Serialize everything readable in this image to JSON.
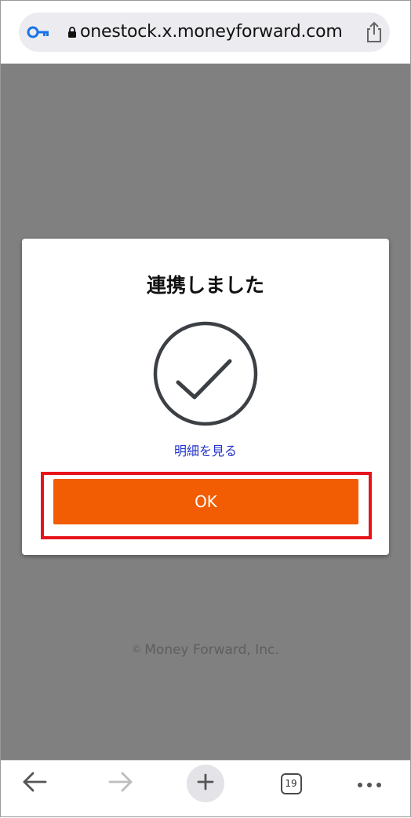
{
  "browser": {
    "url": "onestock.x.moneyforward.com",
    "tab_count": "19",
    "icons": {
      "key": "key-icon",
      "lock": "lock-icon",
      "share": "share-icon",
      "back": "arrow-left-icon",
      "forward": "arrow-right-icon",
      "new_tab": "plus-icon",
      "more": "ellipsis-icon"
    }
  },
  "modal": {
    "title": "連携しました",
    "icon": "check-circle-icon",
    "details_link": "明細を見る",
    "ok_label": "OK"
  },
  "footer": {
    "copyright_mark": "©",
    "copyright_text": "Money Forward, Inc."
  },
  "colors": {
    "accent": "#f25c02",
    "link": "#2233cc",
    "highlight": "#e8141b",
    "overlay": "#808080"
  }
}
